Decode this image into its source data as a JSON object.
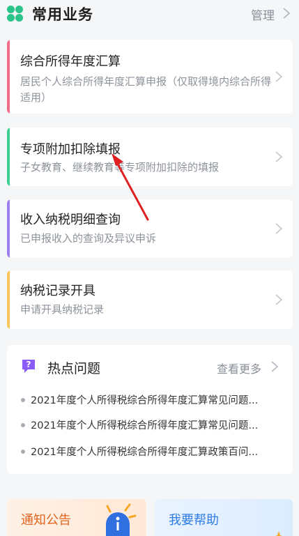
{
  "header": {
    "icon": "clover-icon",
    "title": "常用业务",
    "manage_label": "管理"
  },
  "cards": [
    {
      "title": "综合所得年度汇算",
      "desc": "居民个人综合所得年度汇算申报（仅取得境内综合所得适用）",
      "accent": "#f06a8a"
    },
    {
      "title": "专项附加扣除填报",
      "desc": "子女教育、继续教育等专项附加扣除的填报",
      "accent": "#3ccf91"
    },
    {
      "title": "收入纳税明细查询",
      "desc": "已申报收入的查询及异议申诉",
      "accent": "#9b7ff0"
    },
    {
      "title": "纳税记录开具",
      "desc": "申请开具纳税记录",
      "accent": "#f7c35b"
    }
  ],
  "hot_topics": {
    "icon": "question-chat-icon",
    "title": "热点问题",
    "more_label": "查看更多",
    "items": [
      "2021年度个人所得税综合所得年度汇算常见问题...",
      "2021年度个人所得税综合所得年度汇算常见问题...",
      "2021年度个人所得税综合所得年度汇算政策百问..."
    ]
  },
  "tiles": {
    "notice_label": "通知公告",
    "help_label": "我要帮助"
  },
  "colors": {
    "accent_green": "#2bc48b",
    "annotation_red": "#e02020"
  }
}
